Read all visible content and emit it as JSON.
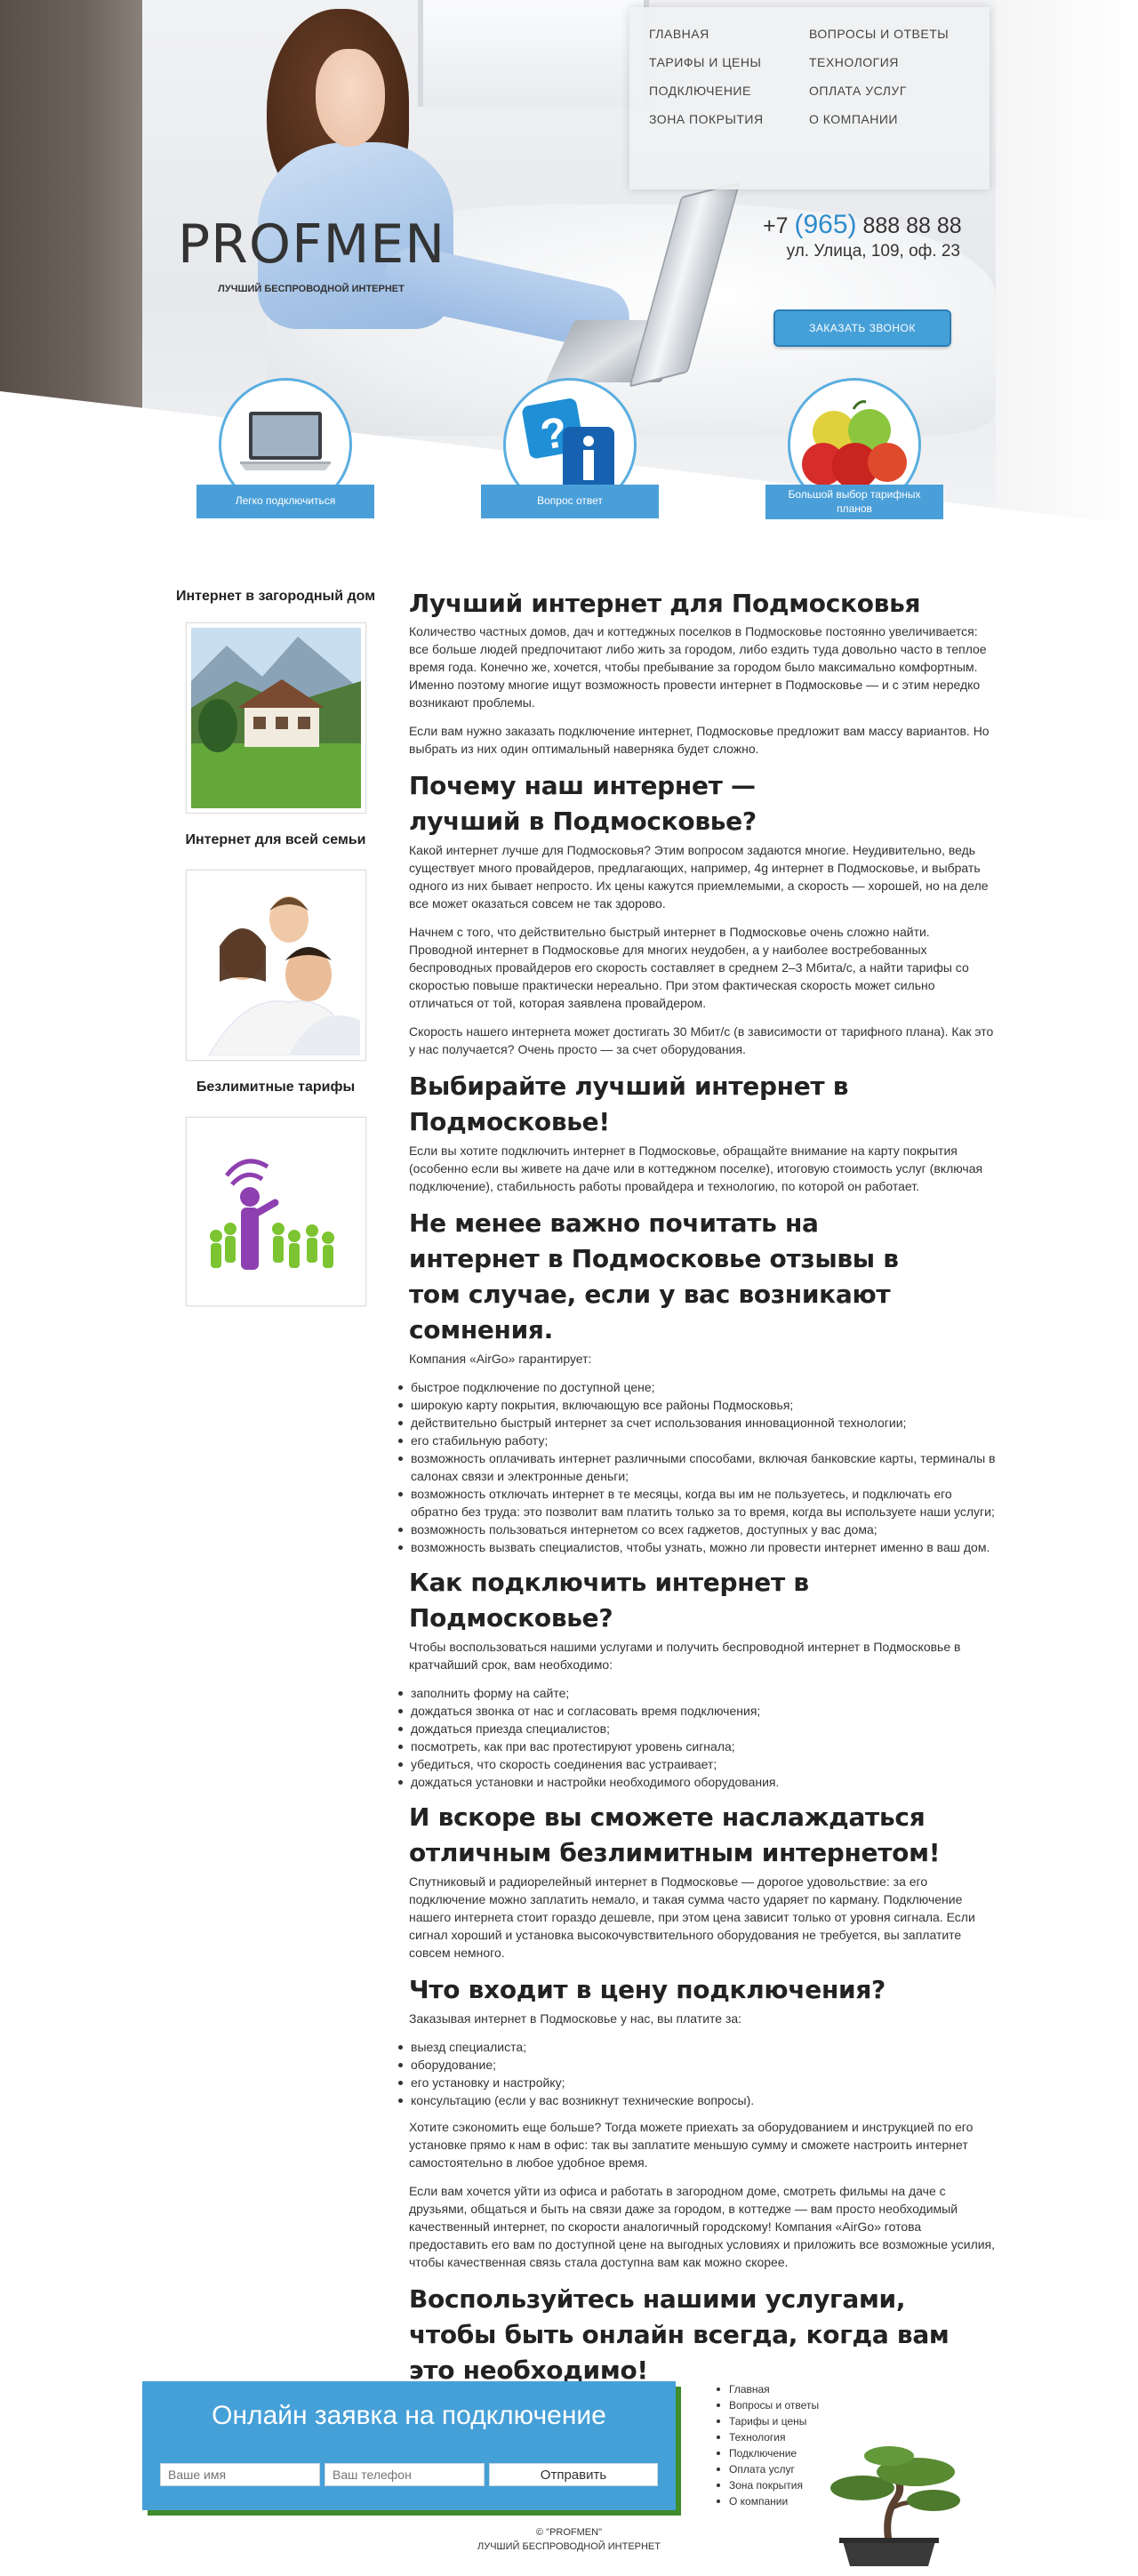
{
  "header": {
    "nav": [
      {
        "label": "Главная"
      },
      {
        "label": "Вопросы и ответы"
      },
      {
        "label": "Тарифы и цены"
      },
      {
        "label": "Технология"
      },
      {
        "label": "Подключение"
      },
      {
        "label": "Оплата услуг"
      },
      {
        "label": "Зона покрытия"
      },
      {
        "label": "О компании"
      }
    ],
    "phone_prefix": "+7",
    "phone_code": "(965)",
    "phone_number": "888 88 88",
    "address": "ул. Улица, 109, оф. 23",
    "call_button": "Заказать звонок",
    "logo": "PROFMEN",
    "tagline": "Лучший беспроводной интернет"
  },
  "features": [
    {
      "label": "Легко подключиться",
      "icon": "laptop-icon"
    },
    {
      "label": "Вопрос ответ",
      "icon": "question-info-icon"
    },
    {
      "label": "Большой выбор тарифных планов",
      "icon": "apples-icon"
    }
  ],
  "sidebar": [
    {
      "title": "Интернет в загородный дом",
      "image": "country-house-image"
    },
    {
      "title": "Интернет для всей семьи",
      "image": "family-image"
    },
    {
      "title": "Безлимитные тарифы",
      "image": "wifi-people-image"
    }
  ],
  "content": {
    "h1": "Лучший интернет для Подмосковья",
    "p1": "Количество частных домов, дач и коттеджных поселков в Подмосковье постоянно увеличивается: все больше людей предпочитают либо жить за городом, либо ездить туда довольно часто в теплое время года. Конечно же, хочется, чтобы пребывание за городом было максимально комфортным. Именно поэтому многие ищут возможность провести интернет в Подмосковье — и с этим нередко возникают проблемы.",
    "p2": "Если вам нужно заказать подключение интернет, Подмосковье предложит вам массу вариантов. Но выбрать из них один оптимальный наверняка будет сложно.",
    "h2_1": "Почему наш интернет — лучший в Подмосковье?",
    "p3": "Какой интернет лучше для Подмосковья? Этим вопросом задаются многие. Неудивительно, ведь существует много провайдеров, предлагающих, например, 4g интернет в Подмосковье, и выбрать одного из них бывает непросто. Их цены кажутся приемлемыми, а скорость — хорошей, но на деле все может оказаться совсем не так здорово.",
    "p4": "Начнем с того, что действительно быстрый интернет в Подмосковье очень сложно найти. Проводной интернет в Подмосковье для многих неудобен, а у наиболее востребованных беспроводных провайдеров его скорость составляет в среднем 2–3 Мбита/с, а найти тарифы со скоростью повыше практически нереально. При этом фактическая скорость может сильно отличаться от той, которая заявлена провайдером.",
    "p5": "Скорость нашего интернета может достигать 30 Мбит/с (в зависимости от тарифного плана). Как это у нас получается? Очень просто — за счет оборудования.",
    "h2_2": "Выбирайте лучший интернет в Подмосковье!",
    "p6": "Если вы хотите подключить интернет в Подмосковье, обращайте внимание на карту покрытия (особенно если вы живете на даче или в коттеджном поселке), итоговую стоимость услуг (включая подключение), стабильность работы провайдера и технологию, по которой он работает.",
    "h2_3": "Не менее важно почитать на интернет в Подмосковье отзывы в том случае, если у вас возникают сомнения.",
    "p7": "Компания «AirGo» гарантирует:",
    "list1": [
      "быстрое подключение по доступной цене;",
      "широкую карту покрытия, включающую все районы Подмосковья;",
      "действительно быстрый интернет за счет использования инновационной технологии;",
      "его стабильную работу;",
      "возможность оплачивать интернет различными способами, включая банковские карты, терминалы в салонах связи и электронные деньги;",
      "возможность отключать интернет в те месяцы, когда вы им не пользуетесь, и подключать его обратно без труда: это позволит вам платить только за то время, когда вы используете наши услуги;",
      "возможность пользоваться интернетом со всех гаджетов, доступных у вас дома;",
      "возможность вызвать специалистов, чтобы узнать, можно ли провести интернет именно в ваш дом."
    ],
    "h2_4": "Как подключить интернет в Подмосковье?",
    "p8": "Чтобы воспользоваться нашими услугами и получить беспроводной интернет в Подмосковье в кратчайший срок, вам необходимо:",
    "list2": [
      "заполнить форму на сайте;",
      "дождаться звонка от нас и согласовать время подключения;",
      "дождаться приезда специалистов;",
      "посмотреть, как при вас протестируют уровень сигнала;",
      "убедиться, что скорость соединения вас устраивает;",
      "дождаться установки и настройки необходимого оборудования."
    ],
    "h2_5": "И вскоре вы сможете наслаждаться отличным безлимитным интернетом!",
    "p9": "Спутниковый и радиорелейный интернет в Подмосковье — дорогое удовольствие: за его подключение можно заплатить немало, и такая сумма часто ударяет по карману. Подключение нашего интернета стоит гораздо дешевле, при этом цена зависит только от уровня сигнала. Если сигнал хороший и установка высокочувствительного оборудования не требуется, вы заплатите совсем немного.",
    "h2_6": "Что входит в цену подключения?",
    "p10": "Заказывая интернет в Подмосковье у нас, вы платите за:",
    "list3": [
      "выезд специалиста;",
      "оборудование;",
      "его установку и настройку;",
      "консультацию (если у вас возникнут технические вопросы)."
    ],
    "p11": "Хотите сэкономить еще больше? Тогда можете приехать за оборудованием и инструкцией по его установке прямо к нам в офис: так вы заплатите меньшую сумму и сможете настроить интернет самостоятельно в любое удобное время.",
    "p12": "Если вам хочется уйти из офиса и работать в загородном доме, смотреть фильмы на даче с друзьями, общаться и быть на связи даже за городом, в коттедже — вам просто необходимый качественный интернет, по скорости аналогичный городскому! Компания «AirGo» готова предоставить его вам по доступной цене на выгодных условиях и приложить все возможные усилия, чтобы качественная связь стала доступна вам как можно скорее.",
    "h2_7": "Воспользуйтесь нашими услугами, чтобы быть онлайн всегда, когда вам это необходимо!"
  },
  "order": {
    "title": "Онлайн заявка на подключение",
    "name_placeholder": "Ваше имя",
    "phone_placeholder": "Ваш телефон",
    "submit": "Отправить"
  },
  "footer": {
    "menu": [
      "Главная",
      "Вопросы и ответы",
      "Тарифы и цены",
      "Технология",
      "Подключение",
      "Оплата услуг",
      "Зона покрытия",
      "О компании"
    ],
    "copyright": "© \"PROFMEN\"",
    "tagline": "Лучший беспроводной интернет"
  },
  "colors": {
    "accent": "#46a0d8",
    "accent_dark": "#2b7db5",
    "shadow_green": "#3e8c2a"
  }
}
